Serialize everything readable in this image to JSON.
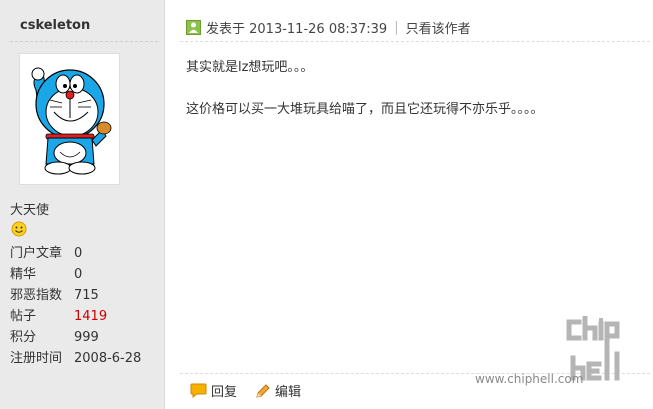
{
  "user": {
    "name": "cskeleton",
    "rank": "大天使",
    "stats": [
      {
        "label": "门户文章",
        "value": "0"
      },
      {
        "label": "精华",
        "value": "0"
      },
      {
        "label": "邪恶指数",
        "value": "715"
      },
      {
        "label": "帖子",
        "value": "1419"
      },
      {
        "label": "积分",
        "value": "999"
      },
      {
        "label": "注册时间",
        "value": "2008-6-28"
      }
    ]
  },
  "post": {
    "posted_at": "发表于 2013-11-26 08:37:39",
    "only_author": "只看该作者",
    "body": [
      "其实就是lz想玩吧。。。",
      "这价格可以买一大堆玩具给喵了，而且它还玩得不亦乐乎。。。。"
    ]
  },
  "actions": {
    "reply": "回复",
    "edit": "编辑"
  },
  "watermark": {
    "url": "www.chiphell.com",
    "logo_text": "chip hell"
  },
  "colors": {
    "sidebar_bg": "#eaeaea",
    "posts_count": "#cc0000",
    "online_icon": "#8bc34a"
  },
  "icons": [
    "online-icon",
    "smiley-icon",
    "reply-icon",
    "edit-icon"
  ]
}
